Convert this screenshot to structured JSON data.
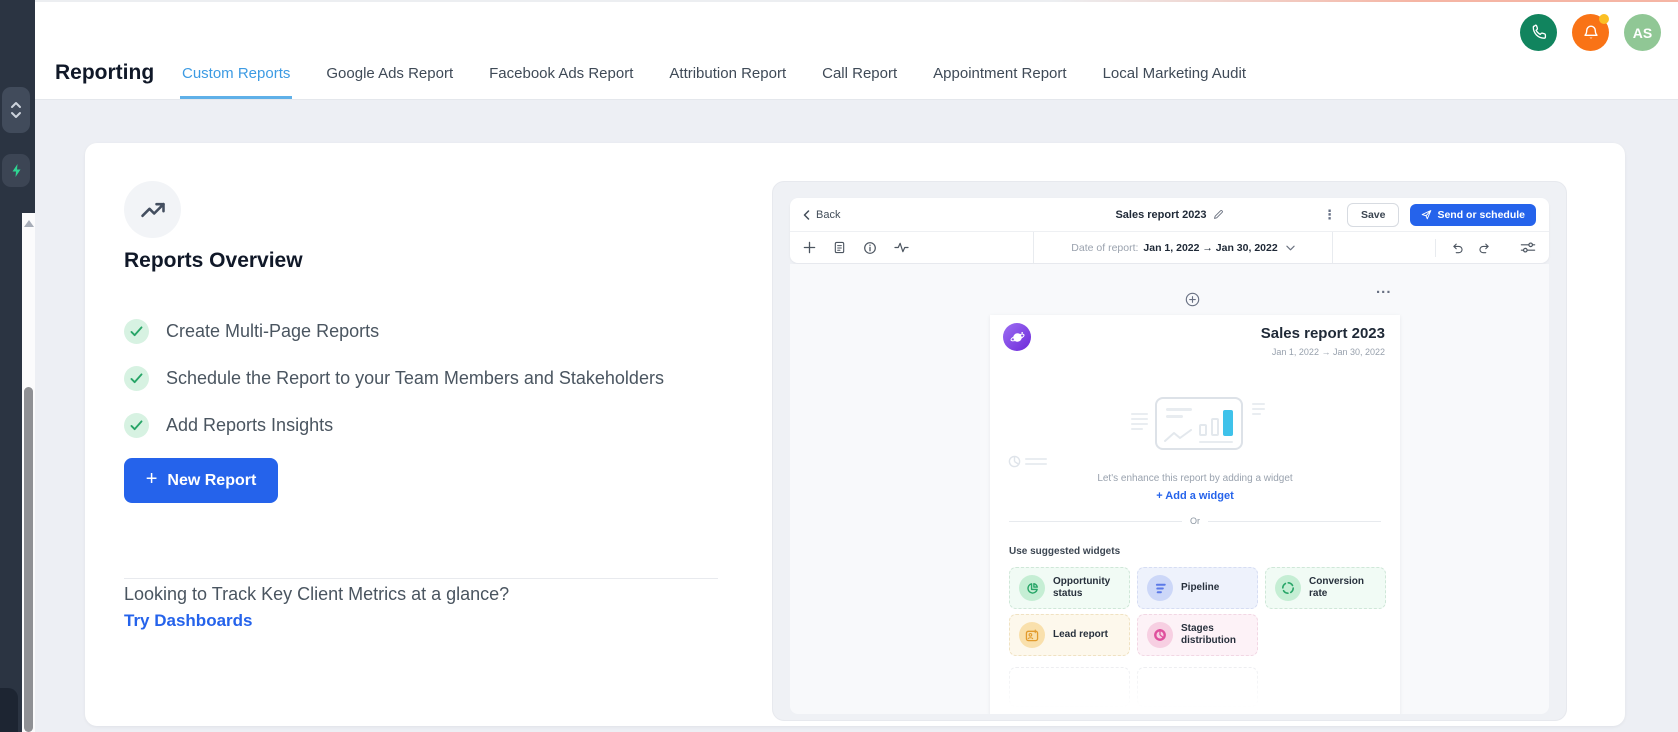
{
  "header": {
    "title": "Reporting",
    "tabs": [
      {
        "label": "Custom Reports",
        "active": true
      },
      {
        "label": "Google Ads Report",
        "active": false
      },
      {
        "label": "Facebook Ads Report",
        "active": false
      },
      {
        "label": "Attribution Report",
        "active": false
      },
      {
        "label": "Call Report",
        "active": false
      },
      {
        "label": "Appointment Report",
        "active": false
      },
      {
        "label": "Local Marketing Audit",
        "active": false
      }
    ],
    "avatar_initials": "AS"
  },
  "overview": {
    "heading": "Reports Overview",
    "checklist": [
      "Create Multi-Page Reports",
      "Schedule the Report to your Team Members and Stakeholders",
      "Add Reports Insights"
    ],
    "new_report_label": "New Report",
    "new_report_plus": "+",
    "footer_question": "Looking to Track Key Client Metrics at a glance?",
    "footer_link": "Try Dashboards"
  },
  "preview": {
    "back_label": "Back",
    "report_title": "Sales report 2023",
    "save_label": "Save",
    "send_label": "Send or schedule",
    "kebab_glyph": "⋮",
    "more_glyph": "...",
    "date_label": "Date of report:",
    "date_value": "Jan 1, 2022 → Jan 30, 2022",
    "page": {
      "title": "Sales report 2023",
      "date_range": "Jan 1, 2022 → Jan 30, 2022",
      "enhance_text": "Let's enhance this report by adding a widget",
      "add_widget_label": "+  Add a widget",
      "or_label": "Or",
      "suggested_label": "Use suggested widgets",
      "widgets": [
        {
          "label": "Opportunity status",
          "icon": "pie-chart-icon",
          "bg": "#f1fbf5",
          "border": "#cfe7d8",
          "icon_bg": "#c5eed4",
          "icon_color": "#27a567"
        },
        {
          "label": "Pipeline",
          "icon": "funnel-icon",
          "bg": "#eef2fc",
          "border": "#d6ddf3",
          "icon_bg": "#ccd7f8",
          "icon_color": "#5b79e8"
        },
        {
          "label": "Conversion rate",
          "icon": "refresh-circle-icon",
          "bg": "#f1fbf5",
          "border": "#cfe7d8",
          "icon_bg": "#c5eed4",
          "icon_color": "#27a567"
        },
        {
          "label": "Lead report",
          "icon": "contact-card-icon",
          "bg": "#fdf8ec",
          "border": "#f0e2c2",
          "icon_bg": "#f9e0ac",
          "icon_color": "#e29b2d"
        },
        {
          "label": "Stages distribution",
          "icon": "donut-icon",
          "bg": "#fdf2f7",
          "border": "#f2d7e4",
          "icon_bg": "#f7cfe2",
          "icon_color": "#df4f9d"
        }
      ]
    }
  },
  "colors": {
    "accent_blue": "#2563eb",
    "tab_active_blue": "#3d9be3",
    "tab_underline": "#5fb0e8",
    "phone_green": "#11845e",
    "bell_orange": "#f97316",
    "badge_yellow": "#fbbf24",
    "avatar_green": "#90c795",
    "sidebar_dark": "#2b3442",
    "bolt_green": "#2fd492",
    "check_green": "#27a567",
    "cyan_bar": "#3fc2ea"
  }
}
